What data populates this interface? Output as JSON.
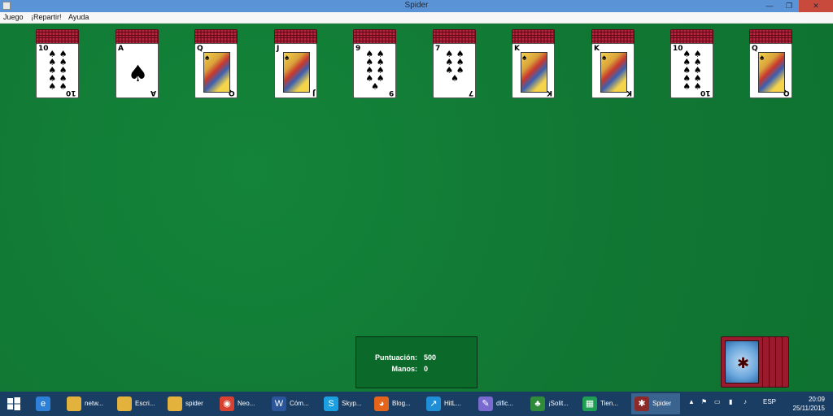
{
  "window": {
    "title": "Spider",
    "minimize_glyph": "—",
    "maximize_glyph": "❐",
    "close_glyph": "✕"
  },
  "menu": {
    "items": [
      "Juego",
      "¡Repartir!",
      "Ayuda"
    ]
  },
  "tableau": {
    "piles": [
      {
        "top_card": {
          "rank": "10",
          "suit": "spade",
          "kind": "pips"
        }
      },
      {
        "top_card": {
          "rank": "A",
          "suit": "spade",
          "kind": "ace"
        }
      },
      {
        "top_card": {
          "rank": "Q",
          "suit": "spade",
          "kind": "court"
        }
      },
      {
        "top_card": {
          "rank": "J",
          "suit": "spade",
          "kind": "court"
        }
      },
      {
        "top_card": {
          "rank": "9",
          "suit": "spade",
          "kind": "pips"
        }
      },
      {
        "top_card": {
          "rank": "7",
          "suit": "spade",
          "kind": "pips"
        }
      },
      {
        "top_card": {
          "rank": "K",
          "suit": "spade",
          "kind": "court"
        }
      },
      {
        "top_card": {
          "rank": "K",
          "suit": "spade",
          "kind": "court"
        }
      },
      {
        "top_card": {
          "rank": "10",
          "suit": "spade",
          "kind": "pips"
        }
      },
      {
        "top_card": {
          "rank": "Q",
          "suit": "spade",
          "kind": "court"
        }
      }
    ],
    "suit_glyph": "♠"
  },
  "score": {
    "score_label": "Puntuación:",
    "score_value": "500",
    "hands_label": "Manos:",
    "hands_value": "0"
  },
  "stock": {
    "remaining_deals": 5,
    "icon": "spider-card-back"
  },
  "taskbar": {
    "start_icon": "windows-logo",
    "items": [
      {
        "label": "",
        "icon": "ie-icon",
        "color": "#2e7fd6",
        "glyph": "e"
      },
      {
        "label": "netw...",
        "icon": "folder-icon",
        "color": "#e3b23c",
        "glyph": ""
      },
      {
        "label": "Escri...",
        "icon": "folder-icon",
        "color": "#e3b23c",
        "glyph": ""
      },
      {
        "label": "spider",
        "icon": "folder-icon",
        "color": "#e3b23c",
        "glyph": ""
      },
      {
        "label": "Neo...",
        "icon": "chrome-icon",
        "color": "#d8412f",
        "glyph": "◉"
      },
      {
        "label": "Cóm...",
        "icon": "word-icon",
        "color": "#2b579a",
        "glyph": "W"
      },
      {
        "label": "Skyp...",
        "icon": "skype-icon",
        "color": "#1a9fe0",
        "glyph": "S"
      },
      {
        "label": "Blog...",
        "icon": "firefox-icon",
        "color": "#e5641c",
        "glyph": "◕"
      },
      {
        "label": "HitL...",
        "icon": "arrow-app-icon",
        "color": "#1f8ed6",
        "glyph": "↗"
      },
      {
        "label": "dific...",
        "icon": "paint-icon",
        "color": "#7a6ad0",
        "glyph": "✎"
      },
      {
        "label": "¡Solit...",
        "icon": "solitaire-icon",
        "color": "#2f8a3a",
        "glyph": "♣"
      },
      {
        "label": "Tien...",
        "icon": "store-icon",
        "color": "#1d9e52",
        "glyph": "▦"
      },
      {
        "label": "Spider",
        "icon": "spider-icon",
        "color": "#8c2a2a",
        "glyph": "✱",
        "active": true
      }
    ],
    "tray": {
      "language": "ESP",
      "time": "20:09",
      "date": "25/11/2015"
    }
  }
}
